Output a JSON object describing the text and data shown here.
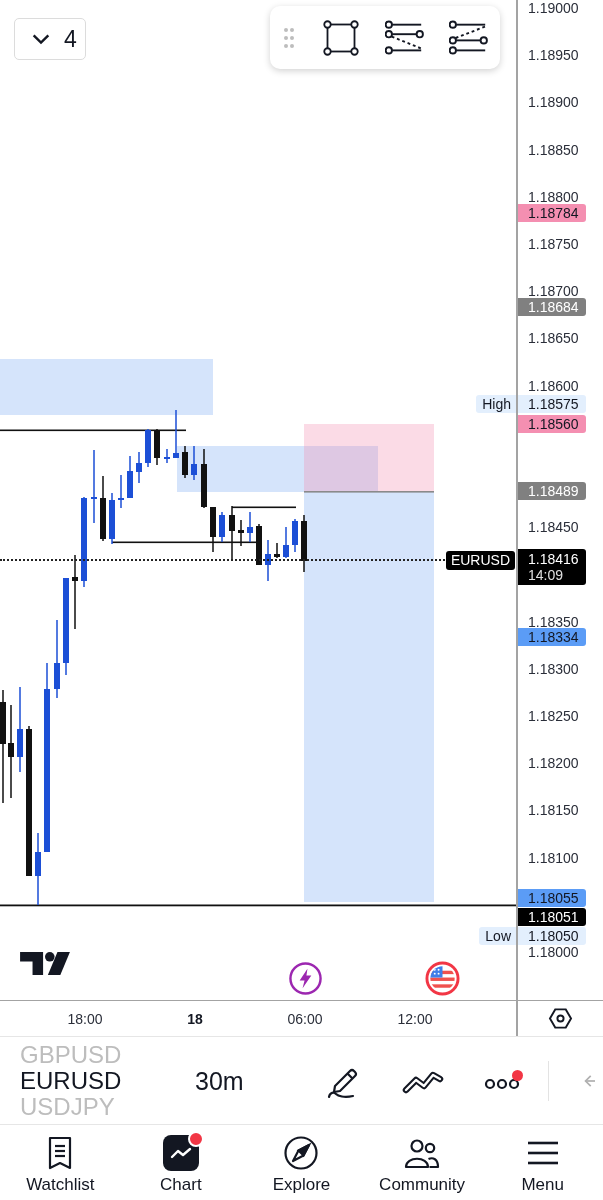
{
  "chart": {
    "collapse_button": {
      "count": "4"
    },
    "price_axis": {
      "ticks": [
        "1.19000",
        "1.18950",
        "1.18900",
        "1.18850",
        "1.18800",
        "1.18750",
        "1.18700",
        "1.18650",
        "1.18600",
        "1.18450",
        "1.18350",
        "1.18300",
        "1.18250",
        "1.18200",
        "1.18150",
        "1.18100",
        "1.18000"
      ]
    },
    "price_labels": [
      {
        "price": "1.18784",
        "color": "#f48fb1"
      },
      {
        "price": "1.18684",
        "color": "#808080"
      },
      {
        "tag": "High",
        "price": "1.18575",
        "color": "#e3effd"
      },
      {
        "price": "1.18560",
        "color": "#f48fb1"
      },
      {
        "price": "1.18489",
        "color": "#808080"
      },
      {
        "price": "1.18334",
        "color": "#5b9cf6"
      },
      {
        "price": "1.18055",
        "color": "#5b9cf6"
      },
      {
        "price": "1.18051",
        "color": "#000000"
      },
      {
        "tag": "Low",
        "price": "1.18050",
        "color": "#e3effd"
      }
    ],
    "last_price": {
      "symbol": "EURUSD",
      "price": "1.18416",
      "countdown": "14:09"
    },
    "time_axis": {
      "labels": [
        {
          "text": "18:00",
          "kind": "time"
        },
        {
          "text": "18",
          "kind": "day"
        },
        {
          "text": "06:00",
          "kind": "time"
        },
        {
          "text": "12:00",
          "kind": "time"
        }
      ]
    }
  },
  "symbol_bar": {
    "symbols": [
      {
        "name": "GBPUSD",
        "selected": false
      },
      {
        "name": "EURUSD",
        "selected": true
      },
      {
        "name": "USDJPY",
        "selected": false
      }
    ],
    "interval": "30m",
    "more_notification": true
  },
  "nav": [
    {
      "label": "Watchlist",
      "kind": "watchlist",
      "selected": false,
      "notification": false
    },
    {
      "label": "Chart",
      "kind": "chart",
      "selected": true,
      "notification": true
    },
    {
      "label": "Explore",
      "kind": "explore",
      "selected": false,
      "notification": false
    },
    {
      "label": "Community",
      "kind": "community",
      "selected": false,
      "notification": false
    },
    {
      "label": "Menu",
      "kind": "menu",
      "selected": false,
      "notification": false
    }
  ]
}
